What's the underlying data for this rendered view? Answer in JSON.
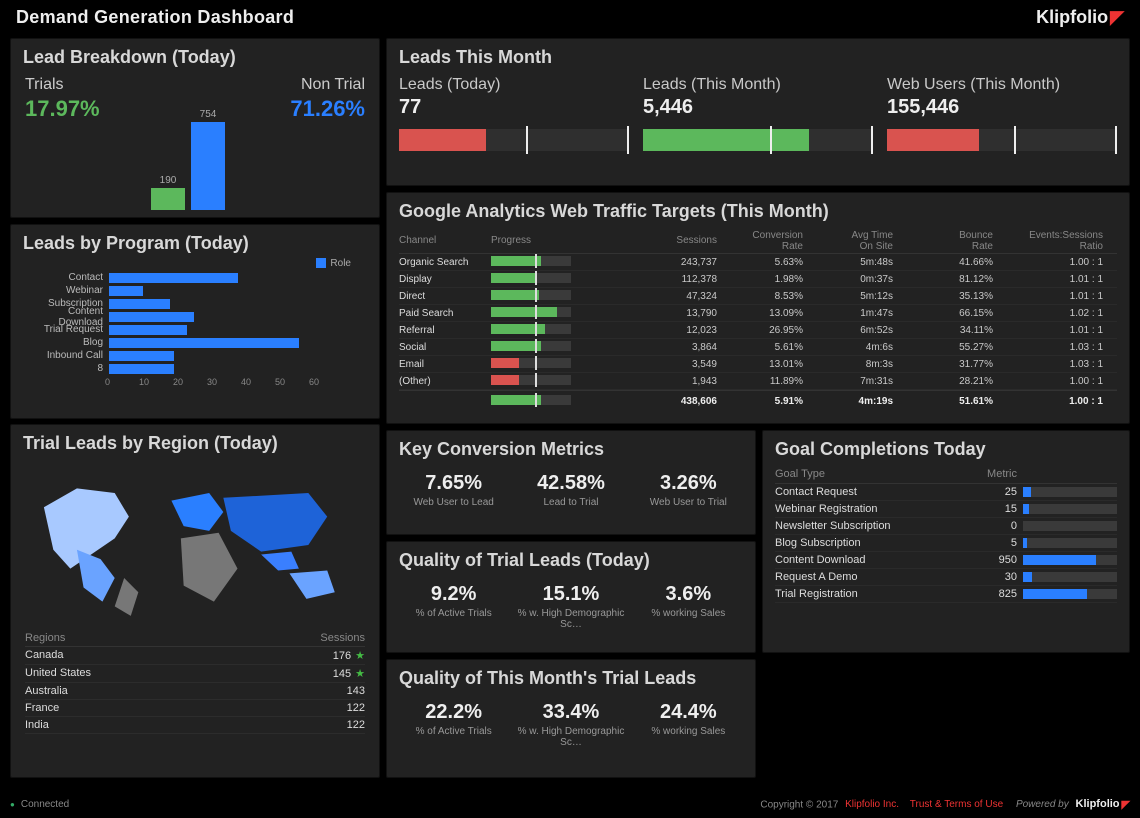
{
  "brand": "Klipfolio",
  "title": "Demand Generation Dashboard",
  "colors": {
    "green": "#5cb85c",
    "blue": "#2a7fff",
    "red": "#d9534f",
    "bar_bg": "#3a3a3a"
  },
  "lead_breakdown": {
    "title": "Lead Breakdown (Today)",
    "trials_label": "Trials",
    "trials_pct": "17.97%",
    "nontrial_label": "Non Trial",
    "nontrial_pct": "71.26%",
    "bars": {
      "trial_n": "190",
      "nontrial_n": "754"
    }
  },
  "leads_by_program": {
    "title": "Leads by Program (Today)",
    "legend": "Role",
    "categories": [
      "Contact",
      "Webinar",
      "Subscription",
      "Content Download",
      "Trial Request",
      "Blog",
      "Inbound Call",
      "8"
    ],
    "values": [
      38,
      10,
      18,
      25,
      23,
      56,
      19,
      19
    ],
    "x_ticks": [
      "0",
      "10",
      "20",
      "30",
      "40",
      "50",
      "60"
    ]
  },
  "trial_leads_region": {
    "title": "Trial Leads by Region (Today)",
    "hdr_region": "Regions",
    "hdr_sessions": "Sessions",
    "rows": [
      {
        "name": "Canada",
        "sessions": "176",
        "star": true
      },
      {
        "name": "United States",
        "sessions": "145",
        "star": true
      },
      {
        "name": "Australia",
        "sessions": "143",
        "star": false
      },
      {
        "name": "France",
        "sessions": "122",
        "star": false
      },
      {
        "name": "India",
        "sessions": "122",
        "star": false
      }
    ]
  },
  "leads_this_month": {
    "title": "Leads This Month",
    "cols": [
      {
        "label": "Leads (Today)",
        "value": "77",
        "fill_pct": 38,
        "fill_color": "#d9534f",
        "target_pct": 55
      },
      {
        "label": "Leads (This Month)",
        "value": "5,446",
        "fill_pct": 72,
        "fill_color": "#5cb85c",
        "target_pct": 55
      },
      {
        "label": "Web Users (This Month)",
        "value": "155,446",
        "fill_pct": 40,
        "fill_color": "#d9534f",
        "target_pct": 55
      }
    ]
  },
  "ga": {
    "title": "Google Analytics Web Traffic Targets (This Month)",
    "hdr": {
      "channel": "Channel",
      "progress": "Progress",
      "sessions": "Sessions",
      "conv": "Conversion\nRate",
      "avg": "Avg Time\nOn Site",
      "bounce": "Bounce\nRate",
      "events": "Events:Sessions\nRatio"
    },
    "rows": [
      {
        "channel": "Organic Search",
        "pr": 63,
        "t": 55,
        "clr": "#5cb85c",
        "sessions": "243,737",
        "conv": "5.63%",
        "avg": "5m:48s",
        "bounce": "41.66%",
        "events": "1.00 : 1"
      },
      {
        "channel": "Display",
        "pr": 56,
        "t": 55,
        "clr": "#5cb85c",
        "sessions": "112,378",
        "conv": "1.98%",
        "avg": "0m:37s",
        "bounce": "81.12%",
        "events": "1.01 : 1"
      },
      {
        "channel": "Direct",
        "pr": 60,
        "t": 55,
        "clr": "#5cb85c",
        "sessions": "47,324",
        "conv": "8.53%",
        "avg": "5m:12s",
        "bounce": "35.13%",
        "events": "1.01 : 1"
      },
      {
        "channel": "Paid Search",
        "pr": 82,
        "t": 55,
        "clr": "#5cb85c",
        "sessions": "13,790",
        "conv": "13.09%",
        "avg": "1m:47s",
        "bounce": "66.15%",
        "events": "1.02 : 1"
      },
      {
        "channel": "Referral",
        "pr": 67,
        "t": 55,
        "clr": "#5cb85c",
        "sessions": "12,023",
        "conv": "26.95%",
        "avg": "6m:52s",
        "bounce": "34.11%",
        "events": "1.01 : 1"
      },
      {
        "channel": "Social",
        "pr": 62,
        "t": 55,
        "clr": "#5cb85c",
        "sessions": "3,864",
        "conv": "5.61%",
        "avg": "4m:6s",
        "bounce": "55.27%",
        "events": "1.03 : 1"
      },
      {
        "channel": "Email",
        "pr": 35,
        "t": 55,
        "clr": "#d9534f",
        "sessions": "3,549",
        "conv": "13.01%",
        "avg": "8m:3s",
        "bounce": "31.77%",
        "events": "1.03 : 1"
      },
      {
        "channel": "(Other)",
        "pr": 35,
        "t": 55,
        "clr": "#d9534f",
        "sessions": "1,943",
        "conv": "11.89%",
        "avg": "7m:31s",
        "bounce": "28.21%",
        "events": "1.00 : 1"
      }
    ],
    "footer": {
      "pr": 62,
      "t": 55,
      "clr": "#5cb85c",
      "sessions": "438,606",
      "conv": "5.91%",
      "avg": "4m:19s",
      "bounce": "51.61%",
      "events": "1.00 : 1"
    }
  },
  "key_conv": {
    "title": "Key Conversion Metrics",
    "cells": [
      {
        "v": "7.65%",
        "l": "Web User to Lead"
      },
      {
        "v": "42.58%",
        "l": "Lead to Trial"
      },
      {
        "v": "3.26%",
        "l": "Web User to Trial"
      }
    ]
  },
  "qtl_today": {
    "title": "Quality of Trial Leads (Today)",
    "cells": [
      {
        "v": "9.2%",
        "l": "% of Active Trials"
      },
      {
        "v": "15.1%",
        "l": "% w. High Demographic Sc…"
      },
      {
        "v": "3.6%",
        "l": "% working Sales"
      }
    ]
  },
  "qtl_month": {
    "title": "Quality of This Month's Trial Leads",
    "cells": [
      {
        "v": "22.2%",
        "l": "% of Active Trials"
      },
      {
        "v": "33.4%",
        "l": "% w. High Demographic Sc…"
      },
      {
        "v": "24.4%",
        "l": "% working Sales"
      }
    ]
  },
  "goal_completions": {
    "title": "Goal Completions Today",
    "hdr": {
      "goal": "Goal Type",
      "metric": "Metric"
    },
    "rows": [
      {
        "goal": "Contact Request",
        "metric": "25",
        "pct": 8
      },
      {
        "goal": "Webinar Registration",
        "metric": "15",
        "pct": 6
      },
      {
        "goal": "Newsletter Subscription",
        "metric": "0",
        "pct": 0
      },
      {
        "goal": "Blog Subscription",
        "metric": "5",
        "pct": 4
      },
      {
        "goal": "Content Download",
        "metric": "950",
        "pct": 78
      },
      {
        "goal": "Request A Demo",
        "metric": "30",
        "pct": 10
      },
      {
        "goal": "Trial Registration",
        "metric": "825",
        "pct": 68
      }
    ]
  },
  "footer": {
    "connected": "Connected",
    "copy": "Copyright © 2017",
    "company": "Klipfolio Inc.",
    "terms": "Trust & Terms of Use",
    "powered": "Powered by"
  },
  "chart_data": [
    {
      "type": "bar",
      "title": "Lead Breakdown (Today)",
      "categories": [
        "Trial",
        "Non Trial"
      ],
      "values": [
        190,
        754
      ]
    },
    {
      "type": "bar",
      "title": "Leads by Program (Today)",
      "orientation": "horizontal",
      "categories": [
        "Contact",
        "Webinar",
        "Subscription",
        "Content Download",
        "Trial Request",
        "Blog",
        "Inbound Call",
        "8"
      ],
      "values": [
        38,
        10,
        18,
        25,
        23,
        56,
        19,
        19
      ],
      "xlim": [
        0,
        60
      ],
      "legend": [
        "Role"
      ]
    }
  ]
}
